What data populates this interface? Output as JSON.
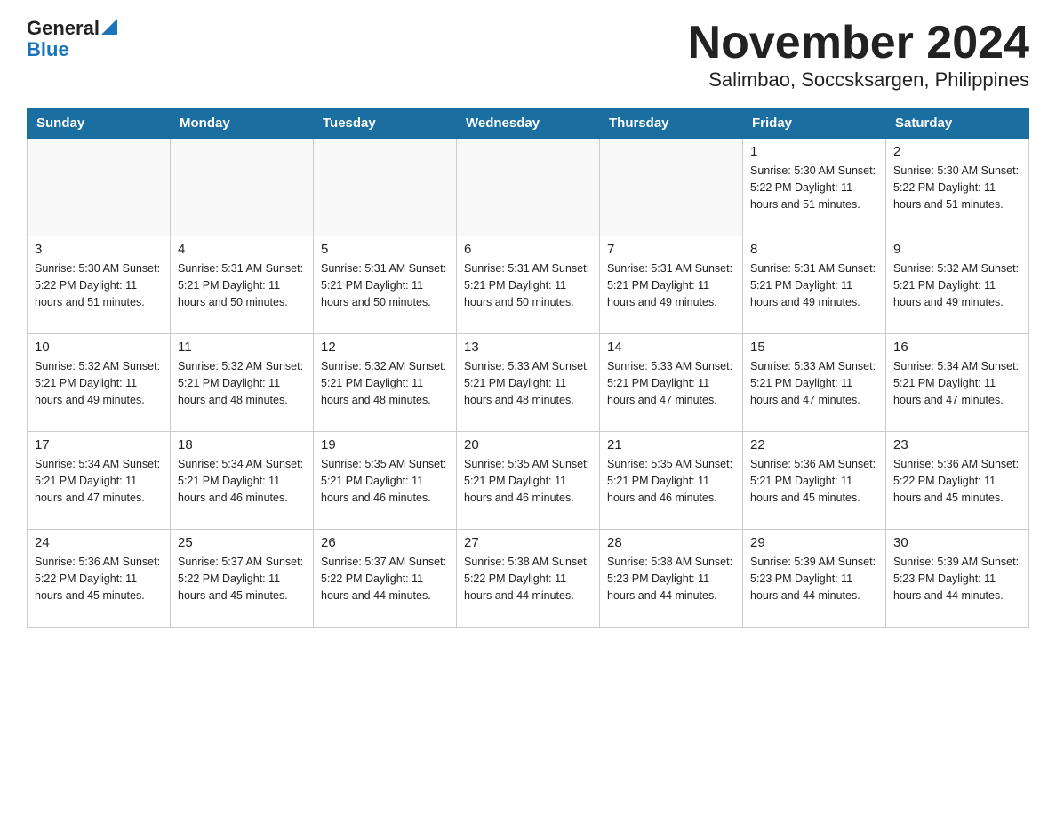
{
  "header": {
    "logo_general": "General",
    "logo_blue": "Blue",
    "title": "November 2024",
    "subtitle": "Salimbao, Soccsksargen, Philippines"
  },
  "days_of_week": [
    "Sunday",
    "Monday",
    "Tuesday",
    "Wednesday",
    "Thursday",
    "Friday",
    "Saturday"
  ],
  "weeks": [
    [
      {
        "day": "",
        "info": ""
      },
      {
        "day": "",
        "info": ""
      },
      {
        "day": "",
        "info": ""
      },
      {
        "day": "",
        "info": ""
      },
      {
        "day": "",
        "info": ""
      },
      {
        "day": "1",
        "info": "Sunrise: 5:30 AM\nSunset: 5:22 PM\nDaylight: 11 hours and 51 minutes."
      },
      {
        "day": "2",
        "info": "Sunrise: 5:30 AM\nSunset: 5:22 PM\nDaylight: 11 hours and 51 minutes."
      }
    ],
    [
      {
        "day": "3",
        "info": "Sunrise: 5:30 AM\nSunset: 5:22 PM\nDaylight: 11 hours and 51 minutes."
      },
      {
        "day": "4",
        "info": "Sunrise: 5:31 AM\nSunset: 5:21 PM\nDaylight: 11 hours and 50 minutes."
      },
      {
        "day": "5",
        "info": "Sunrise: 5:31 AM\nSunset: 5:21 PM\nDaylight: 11 hours and 50 minutes."
      },
      {
        "day": "6",
        "info": "Sunrise: 5:31 AM\nSunset: 5:21 PM\nDaylight: 11 hours and 50 minutes."
      },
      {
        "day": "7",
        "info": "Sunrise: 5:31 AM\nSunset: 5:21 PM\nDaylight: 11 hours and 49 minutes."
      },
      {
        "day": "8",
        "info": "Sunrise: 5:31 AM\nSunset: 5:21 PM\nDaylight: 11 hours and 49 minutes."
      },
      {
        "day": "9",
        "info": "Sunrise: 5:32 AM\nSunset: 5:21 PM\nDaylight: 11 hours and 49 minutes."
      }
    ],
    [
      {
        "day": "10",
        "info": "Sunrise: 5:32 AM\nSunset: 5:21 PM\nDaylight: 11 hours and 49 minutes."
      },
      {
        "day": "11",
        "info": "Sunrise: 5:32 AM\nSunset: 5:21 PM\nDaylight: 11 hours and 48 minutes."
      },
      {
        "day": "12",
        "info": "Sunrise: 5:32 AM\nSunset: 5:21 PM\nDaylight: 11 hours and 48 minutes."
      },
      {
        "day": "13",
        "info": "Sunrise: 5:33 AM\nSunset: 5:21 PM\nDaylight: 11 hours and 48 minutes."
      },
      {
        "day": "14",
        "info": "Sunrise: 5:33 AM\nSunset: 5:21 PM\nDaylight: 11 hours and 47 minutes."
      },
      {
        "day": "15",
        "info": "Sunrise: 5:33 AM\nSunset: 5:21 PM\nDaylight: 11 hours and 47 minutes."
      },
      {
        "day": "16",
        "info": "Sunrise: 5:34 AM\nSunset: 5:21 PM\nDaylight: 11 hours and 47 minutes."
      }
    ],
    [
      {
        "day": "17",
        "info": "Sunrise: 5:34 AM\nSunset: 5:21 PM\nDaylight: 11 hours and 47 minutes."
      },
      {
        "day": "18",
        "info": "Sunrise: 5:34 AM\nSunset: 5:21 PM\nDaylight: 11 hours and 46 minutes."
      },
      {
        "day": "19",
        "info": "Sunrise: 5:35 AM\nSunset: 5:21 PM\nDaylight: 11 hours and 46 minutes."
      },
      {
        "day": "20",
        "info": "Sunrise: 5:35 AM\nSunset: 5:21 PM\nDaylight: 11 hours and 46 minutes."
      },
      {
        "day": "21",
        "info": "Sunrise: 5:35 AM\nSunset: 5:21 PM\nDaylight: 11 hours and 46 minutes."
      },
      {
        "day": "22",
        "info": "Sunrise: 5:36 AM\nSunset: 5:21 PM\nDaylight: 11 hours and 45 minutes."
      },
      {
        "day": "23",
        "info": "Sunrise: 5:36 AM\nSunset: 5:22 PM\nDaylight: 11 hours and 45 minutes."
      }
    ],
    [
      {
        "day": "24",
        "info": "Sunrise: 5:36 AM\nSunset: 5:22 PM\nDaylight: 11 hours and 45 minutes."
      },
      {
        "day": "25",
        "info": "Sunrise: 5:37 AM\nSunset: 5:22 PM\nDaylight: 11 hours and 45 minutes."
      },
      {
        "day": "26",
        "info": "Sunrise: 5:37 AM\nSunset: 5:22 PM\nDaylight: 11 hours and 44 minutes."
      },
      {
        "day": "27",
        "info": "Sunrise: 5:38 AM\nSunset: 5:22 PM\nDaylight: 11 hours and 44 minutes."
      },
      {
        "day": "28",
        "info": "Sunrise: 5:38 AM\nSunset: 5:23 PM\nDaylight: 11 hours and 44 minutes."
      },
      {
        "day": "29",
        "info": "Sunrise: 5:39 AM\nSunset: 5:23 PM\nDaylight: 11 hours and 44 minutes."
      },
      {
        "day": "30",
        "info": "Sunrise: 5:39 AM\nSunset: 5:23 PM\nDaylight: 11 hours and 44 minutes."
      }
    ]
  ]
}
